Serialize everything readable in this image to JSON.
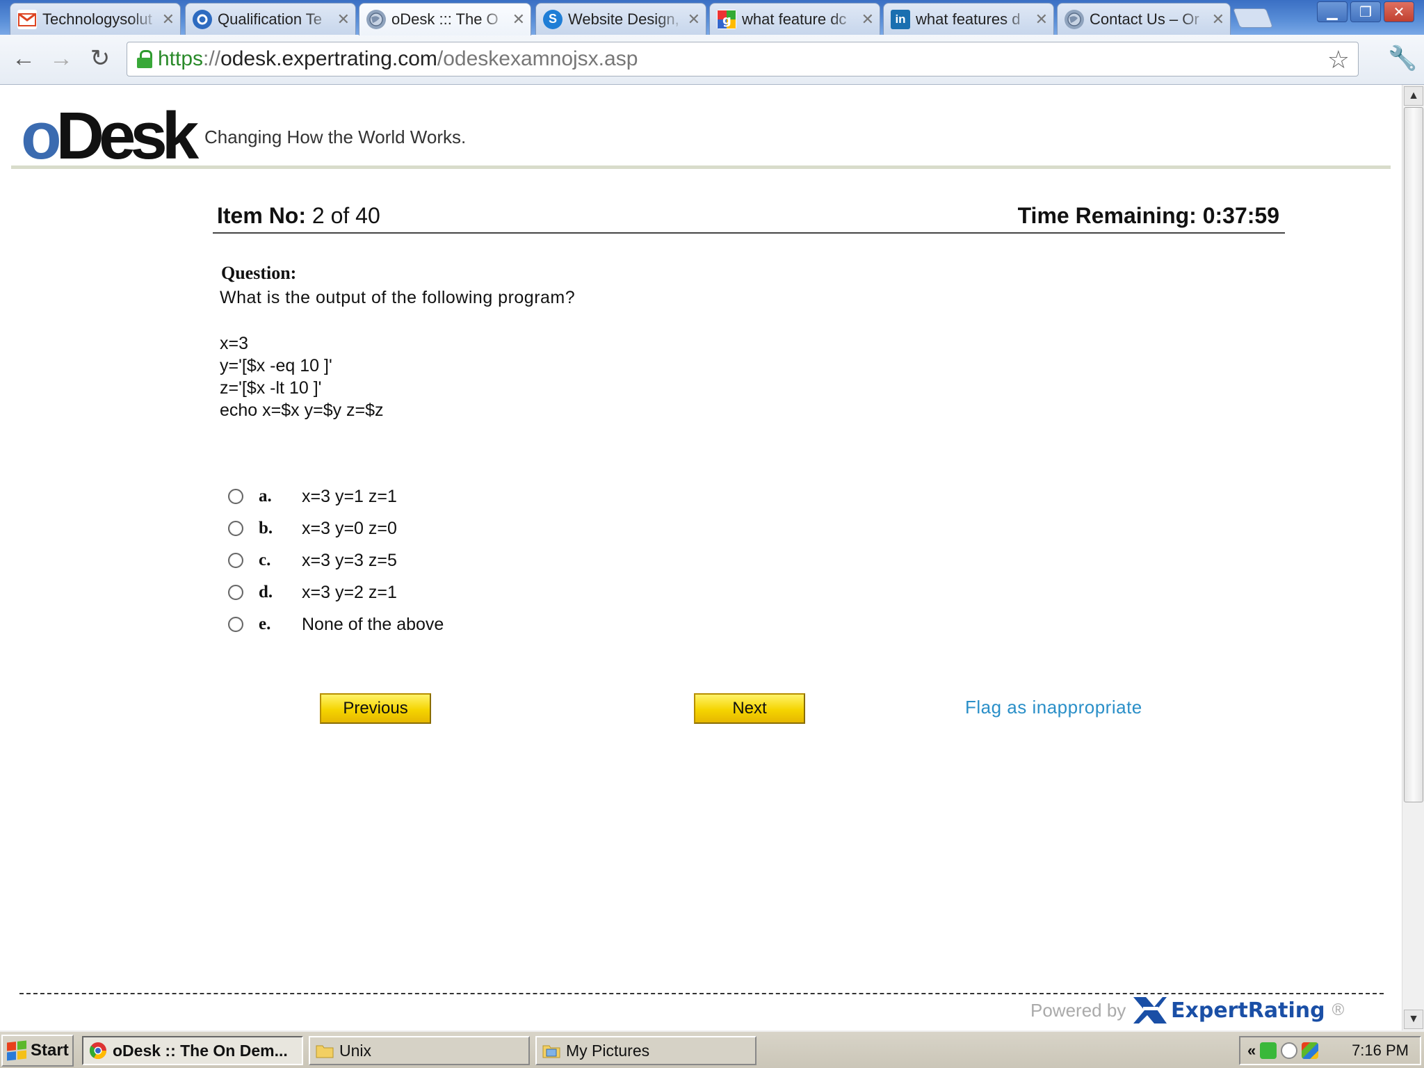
{
  "browser": {
    "tabs": [
      {
        "title": "Technologysolut",
        "icon": "gmail-icon",
        "active": false
      },
      {
        "title": "Qualification Te",
        "icon": "odesk-icon",
        "active": false
      },
      {
        "title": "oDesk ::: The O",
        "icon": "globe-icon",
        "active": true
      },
      {
        "title": "Website Design,",
        "icon": "skype-icon",
        "active": false
      },
      {
        "title": "what feature dc",
        "icon": "google-icon",
        "active": false
      },
      {
        "title": "what features d",
        "icon": "linkedin-icon",
        "active": false
      },
      {
        "title": "Contact Us – Or",
        "icon": "globe-icon",
        "active": false
      }
    ],
    "url": {
      "scheme": "https",
      "rest": "://",
      "host": "odesk.expertrating.com",
      "path": "/odeskexamnojsx.asp"
    }
  },
  "page": {
    "logo_o": "o",
    "logo_rest": "Desk",
    "tagline": "Changing How the World Works.",
    "item_label": "Item No:",
    "item_value": "2 of 40",
    "time_remaining": "Time Remaining: 0:37:59",
    "question_label": "Question:",
    "question_text": "What is the output of the following program?",
    "code_lines": [
      "x=3",
      "y='[$x -eq 10 ]'",
      "z='[$x -lt 10 ]'",
      "echo x=$x y=$y z=$z"
    ],
    "options": [
      {
        "letter": "a.",
        "text": "x=3 y=1 z=1"
      },
      {
        "letter": "b.",
        "text": "x=3 y=0 z=0"
      },
      {
        "letter": "c.",
        "text": "x=3 y=3 z=5"
      },
      {
        "letter": "d.",
        "text": "x=3 y=2 z=1"
      },
      {
        "letter": "e.",
        "text": "None of the above"
      }
    ],
    "previous_label": "Previous",
    "next_label": "Next",
    "flag_label": "Flag as inappropriate",
    "powered_by": "Powered by",
    "expert_rating": "ExpertRating",
    "registered": "®"
  },
  "taskbar": {
    "start_label": "Start",
    "tasks": [
      {
        "label": "oDesk :: The On Dem...",
        "icon": "chrome-icon",
        "active": true
      },
      {
        "label": "Unix",
        "icon": "folder-icon",
        "active": false
      },
      {
        "label": "My Pictures",
        "icon": "pictures-folder-icon",
        "active": false
      }
    ],
    "tray_chevron": "«",
    "clock": "7:16 PM"
  },
  "colors": {
    "accent_link": "#2a8fc8",
    "button_yellow": "#f5d400",
    "odesk_blue": "#3b6bb0",
    "expertrating_blue": "#1a4fa6"
  }
}
